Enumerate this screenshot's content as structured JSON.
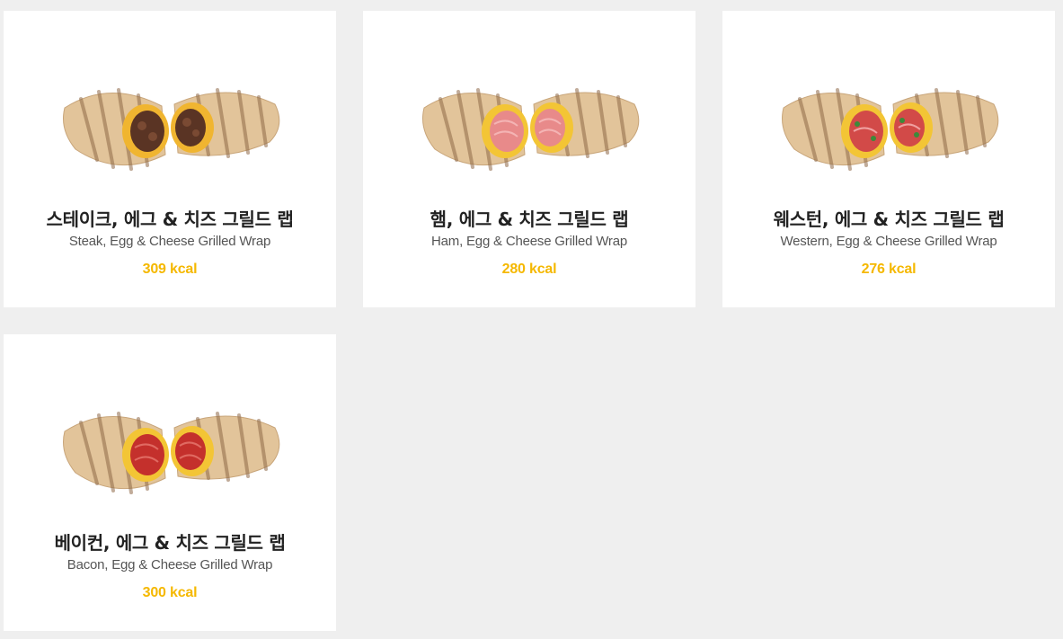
{
  "menu": {
    "items": [
      {
        "name_ko": "스테이크, 에그 & 치즈 그릴드 랩",
        "name_en": "Steak, Egg & Cheese Grilled Wrap",
        "kcal": "309 kcal",
        "filling": "steak",
        "filling_color": "#5a3424",
        "filling_accent": "#f0b530"
      },
      {
        "name_ko": "햄, 에그 & 치즈 그릴드 랩",
        "name_en": "Ham, Egg & Cheese Grilled Wrap",
        "kcal": "280 kcal",
        "filling": "ham",
        "filling_color": "#e88a8a",
        "filling_accent": "#f3c535"
      },
      {
        "name_ko": "웨스턴, 에그 & 치즈 그릴드 랩",
        "name_en": "Western, Egg & Cheese Grilled Wrap",
        "kcal": "276 kcal",
        "filling": "western",
        "filling_color": "#d24a48",
        "filling_accent": "#f3c535"
      },
      {
        "name_ko": "베이컨, 에그 & 치즈 그릴드 랩",
        "name_en": "Bacon, Egg & Cheese Grilled Wrap",
        "kcal": "300 kcal",
        "filling": "bacon",
        "filling_color": "#c4302c",
        "filling_accent": "#f3c535"
      }
    ]
  },
  "colors": {
    "background": "#efefef",
    "card": "#ffffff",
    "kcal": "#f5b800",
    "title": "#222222",
    "subtitle": "#555555",
    "tortilla": "#e2c49a",
    "grill_marks": "#8f6a48"
  }
}
